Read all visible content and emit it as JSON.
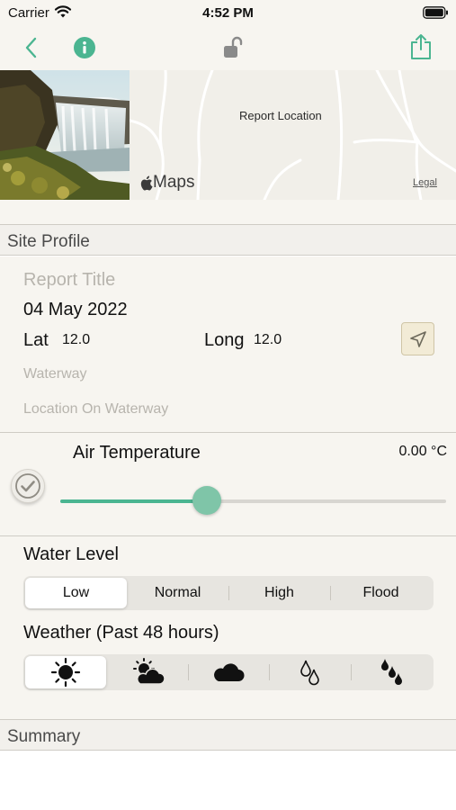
{
  "status_bar": {
    "carrier": "Carrier",
    "time": "4:52 PM",
    "icons": [
      "wifi-icon",
      "battery-icon"
    ]
  },
  "nav_bar": {
    "icons": [
      "back-chevron-icon",
      "info-icon",
      "unlocked-padlock-icon",
      "share-icon"
    ],
    "accent_color": "#4bb591"
  },
  "map": {
    "pin_label": "Report Location",
    "brand": "Maps",
    "legal_link": "Legal"
  },
  "site_profile": {
    "header": "Site Profile",
    "report_title_placeholder": "Report Title",
    "date": "04 May 2022",
    "lat_label": "Lat",
    "lat_value": "12.0",
    "long_label": "Long",
    "long_value": "12.0",
    "waterway_placeholder": "Waterway",
    "location_on_waterway_placeholder": "Location On Waterway",
    "locate_icon": "location-arrow-icon"
  },
  "air_temperature": {
    "title": "Air Temperature",
    "value": "0.00 °C",
    "slider_fraction": 0.38,
    "check_icon": "checkmark-icon"
  },
  "water_level": {
    "label": "Water Level",
    "options": [
      "Low",
      "Normal",
      "High",
      "Flood"
    ],
    "selected": "Low"
  },
  "weather": {
    "label": "Weather (Past 48 hours)",
    "options": [
      "sun-icon",
      "partly-cloudy-icon",
      "cloud-icon",
      "light-rain-icon",
      "heavy-rain-icon"
    ],
    "selected": "sun-icon"
  },
  "summary": {
    "header": "Summary"
  }
}
